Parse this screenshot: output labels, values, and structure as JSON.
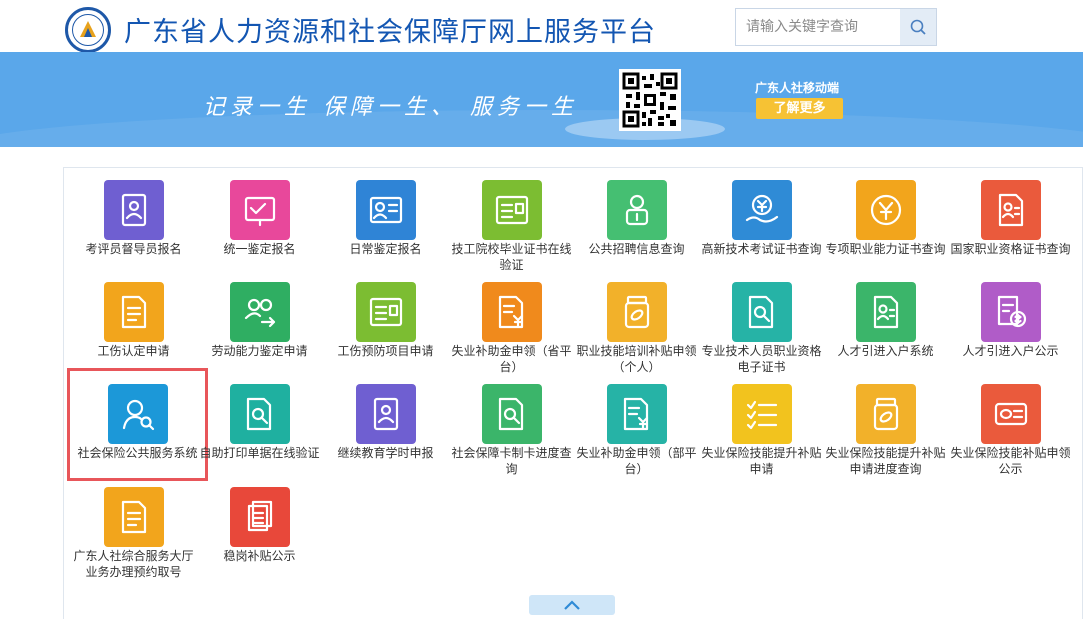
{
  "header": {
    "title": "广东省人力资源和社会保障厅网上服务平台",
    "search_placeholder": "请输入关键字查询"
  },
  "banner": {
    "slogan": "记录一生  保障一生、  服务一生",
    "mobile_label": "广东人社移动端",
    "learn_more": "了解更多"
  },
  "services": [
    {
      "label": "考评员督导员报名",
      "color": "#6f5fd1",
      "icon": "badge-person-icon"
    },
    {
      "label": "统一鉴定报名",
      "color": "#e8489b",
      "icon": "check-board-icon"
    },
    {
      "label": "日常鉴定报名",
      "color": "#2f84d6",
      "icon": "id-card-icon"
    },
    {
      "label": "技工院校毕业证书在线验证",
      "color": "#7cbd32",
      "icon": "certificate-icon"
    },
    {
      "label": "公共招聘信息查询",
      "color": "#45bf72",
      "icon": "briefcase-person-icon"
    },
    {
      "label": "高新技术考试证书查询",
      "color": "#2f8bd6",
      "icon": "yen-hand-icon"
    },
    {
      "label": "专项职业能力证书查询",
      "color": "#f2a51c",
      "icon": "yen-coin-icon"
    },
    {
      "label": "国家职业资格证书查询",
      "color": "#ea5a3c",
      "icon": "document-person-icon"
    },
    {
      "label": "工伤认定申请",
      "color": "#f2a51c",
      "icon": "document-list-icon"
    },
    {
      "label": "劳动能力鉴定申请",
      "color": "#2fae62",
      "icon": "people-exchange-icon"
    },
    {
      "label": "工伤预防项目申请",
      "color": "#7cbd32",
      "icon": "certificate-icon"
    },
    {
      "label": "失业补助金申领（省平台）",
      "color": "#f08a1c",
      "icon": "yen-document-icon"
    },
    {
      "label": "职业技能培训补贴申领（个人）",
      "color": "#f2b12a",
      "icon": "medicine-bottle-icon"
    },
    {
      "label": "专业技术人员职业资格电子证书",
      "color": "#26b3a6",
      "icon": "search-document-icon"
    },
    {
      "label": "人才引进入户系统",
      "color": "#3bb56a",
      "icon": "document-person-icon"
    },
    {
      "label": "人才引进入户公示",
      "color": "#b05cc8",
      "icon": "document-money-icon"
    },
    {
      "label": "社会保险公共服务系统",
      "color": "#1c98d8",
      "icon": "person-search-icon"
    },
    {
      "label": "自助打印单据在线验证",
      "color": "#1fb0a0",
      "icon": "search-document-icon"
    },
    {
      "label": "继续教育学时申报",
      "color": "#6f5fd1",
      "icon": "badge-person-icon"
    },
    {
      "label": "社会保障卡制卡进度查询",
      "color": "#3bb56a",
      "icon": "search-document-icon"
    },
    {
      "label": "失业补助金申领（部平台）",
      "color": "#26b3a6",
      "icon": "yen-document-icon"
    },
    {
      "label": "失业保险技能提升补贴申请",
      "color": "#f2c31e",
      "icon": "checklist-icon"
    },
    {
      "label": "失业保险技能提升补贴申请进度查询",
      "color": "#f2b12a",
      "icon": "medicine-bottle-icon"
    },
    {
      "label": "失业保险技能补贴申领公示",
      "color": "#ea5a3c",
      "icon": "card-icon"
    },
    {
      "label": "广东人社综合服务大厅业务办理预约取号",
      "color": "#f2a51c",
      "icon": "document-list-icon"
    },
    {
      "label": "稳岗补贴公示",
      "color": "#e8483a",
      "icon": "stacked-pages-icon"
    }
  ]
}
